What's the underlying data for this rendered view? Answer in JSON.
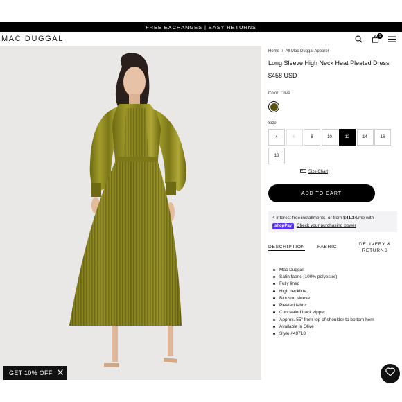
{
  "promo": {
    "text": "FREE EXCHANGES | EASY RETURNS"
  },
  "header": {
    "logo": "MAC DUGGAL",
    "bag_count": "1"
  },
  "product": {
    "breadcrumb": [
      "Home",
      "/",
      "All Mac Duggal Apparel"
    ],
    "title": "Long Sleeve High Neck Heat Pleated Dress",
    "price": "$458 USD",
    "color_label": "Color: Olive",
    "swatch_color": "#5c5314",
    "size_label": "Size:",
    "sizes": [
      {
        "label": "4",
        "state": "available"
      },
      {
        "label": "6",
        "state": "disabled"
      },
      {
        "label": "8",
        "state": "available"
      },
      {
        "label": "10",
        "state": "available"
      },
      {
        "label": "12",
        "state": "selected"
      },
      {
        "label": "14",
        "state": "available"
      },
      {
        "label": "16",
        "state": "available"
      },
      {
        "label": "18",
        "state": "available"
      }
    ],
    "size_chart": "Size Chart",
    "add_to_cart": "ADD TO CART",
    "installments": {
      "prefix": "4 interest-free installments, or from",
      "amount": "$41.34",
      "suffix": "/mo with",
      "shop_pay": "shopPay",
      "link": "Check your purchasing power"
    },
    "tabs": {
      "description": "DESCRIPTION",
      "fabric": "FABRIC",
      "delivery_line1": "DELIVERY &",
      "delivery_line2": "RETURNS"
    },
    "description_items": [
      "Mac Duggal",
      "Satin fabric (100% polyester)",
      "Fully lined",
      "High neckline",
      "Blouson sleeve",
      "Pleated fabric",
      "Concealed back zipper",
      "Approx. 55\" from top of shoulder to bottom hem",
      "Available in Olive",
      "Style #49718"
    ]
  },
  "popup": {
    "text": "GET 10% OFF"
  },
  "colors": {
    "accent": "#000000",
    "dress": "#8a861f",
    "shop_pay": "#5a31f4"
  }
}
